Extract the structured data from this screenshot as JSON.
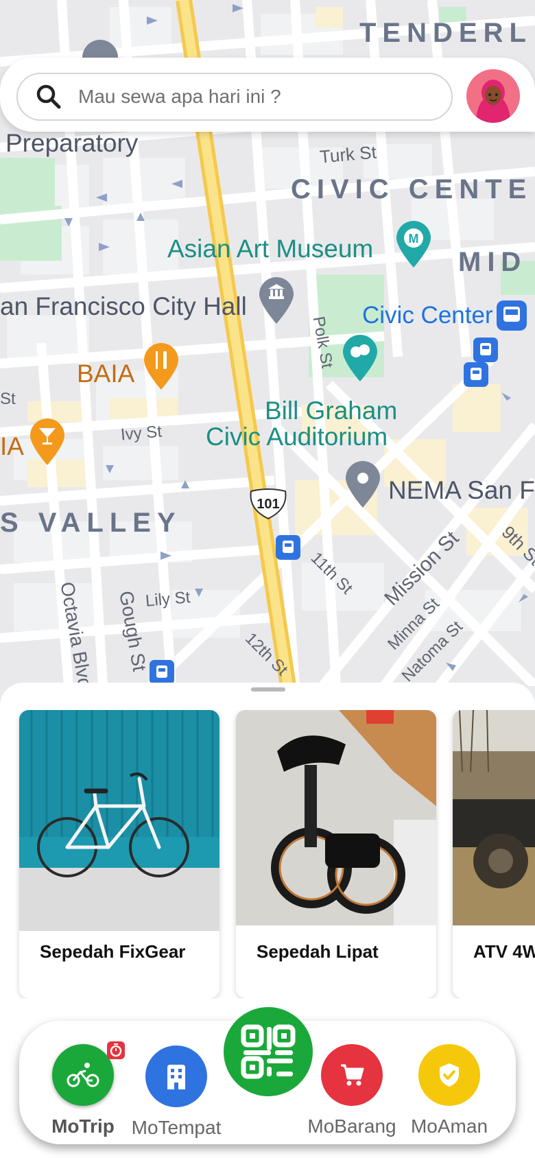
{
  "search": {
    "placeholder": "Mau sewa apa hari ini ?"
  },
  "map": {
    "districts": [
      "TENDERL",
      "CIVIC CENTE",
      "MID",
      "S VALLEY"
    ],
    "pois": {
      "asian_art": "Asian Art Museum",
      "city_hall": "an Francisco City Hall",
      "civic_center": "Civic Center",
      "baia": "BAIA",
      "bill_graham_1": "Bill Graham",
      "bill_graham_2": "Civic Auditorium",
      "nema": "NEMA San F",
      "preparatory": "Preparatory",
      "ia": "IA"
    },
    "streets": {
      "turk": "Turk St",
      "polk": "Polk St",
      "ivy": "Ivy St",
      "eleventh": "11th St",
      "mission": "Mission St",
      "ninth": "9th St",
      "minna": "Minna St",
      "natoma": "Natoma St",
      "lily": "Lily St",
      "gough": "Gough St",
      "octavia": "Octavia Blvd",
      "twelfth": "12th St",
      "st": "St"
    },
    "highway": "101"
  },
  "products": [
    {
      "title": "Sepedah FixGear"
    },
    {
      "title": "Sepedah Lipat"
    },
    {
      "title": "ATV 4W"
    }
  ],
  "nav": {
    "motrip": "MoTrip",
    "motempat": "MoTempat",
    "mobarang": "MoBarang",
    "moaman": "MoAman"
  },
  "colors": {
    "green": "#1ba83a",
    "blue": "#2f73e0",
    "red": "#e5333f",
    "yellow": "#f5c80b",
    "teal": "#1a8f84"
  }
}
